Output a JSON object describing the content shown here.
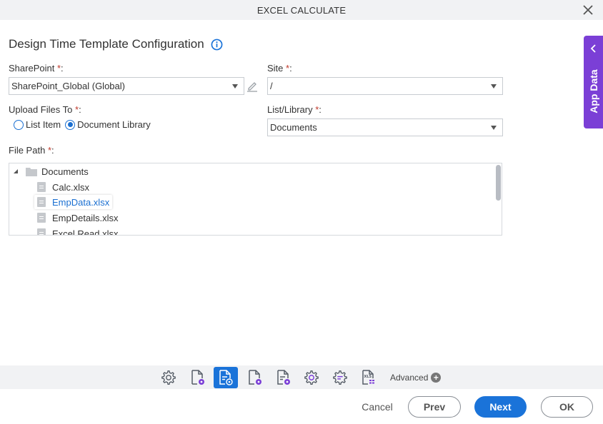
{
  "window": {
    "title": "EXCEL CALCULATE"
  },
  "heading": "Design Time Template Configuration",
  "form": {
    "sharepoint": {
      "label": "SharePoint",
      "required": "*",
      "colon": ":",
      "value": "SharePoint_Global (Global)"
    },
    "site": {
      "label": "Site",
      "required": "*",
      "colon": ":",
      "value": "/"
    },
    "upload": {
      "label": "Upload Files To",
      "required": "*",
      "colon": ":",
      "options": [
        {
          "label": "List Item",
          "selected": false
        },
        {
          "label": "Document Library",
          "selected": true
        }
      ]
    },
    "list_library": {
      "label": "List/Library",
      "required": "*",
      "colon": ":",
      "value": "Documents"
    },
    "file_path": {
      "label": "File Path",
      "required": "*",
      "colon": ":",
      "root": "Documents",
      "files": [
        "Calc.xlsx",
        "EmpData.xlsx",
        "EmpDetails.xlsx",
        "Excel Read.xlsx"
      ],
      "selected": "EmpData.xlsx"
    }
  },
  "app_data": {
    "label": "App Data"
  },
  "toolbar": {
    "icons": [
      "settings-gear",
      "document-settings",
      "document-lines-settings",
      "document-settings-2",
      "document-lines-settings-2",
      "gear",
      "gear-lines",
      "xls-file"
    ],
    "active_index": 2,
    "advanced_label": "Advanced"
  },
  "footer": {
    "cancel": "Cancel",
    "prev": "Prev",
    "next": "Next",
    "ok": "OK"
  },
  "colors": {
    "accent": "#1a73d9",
    "app_data": "#7b3fd6",
    "required": "#c0392b"
  }
}
